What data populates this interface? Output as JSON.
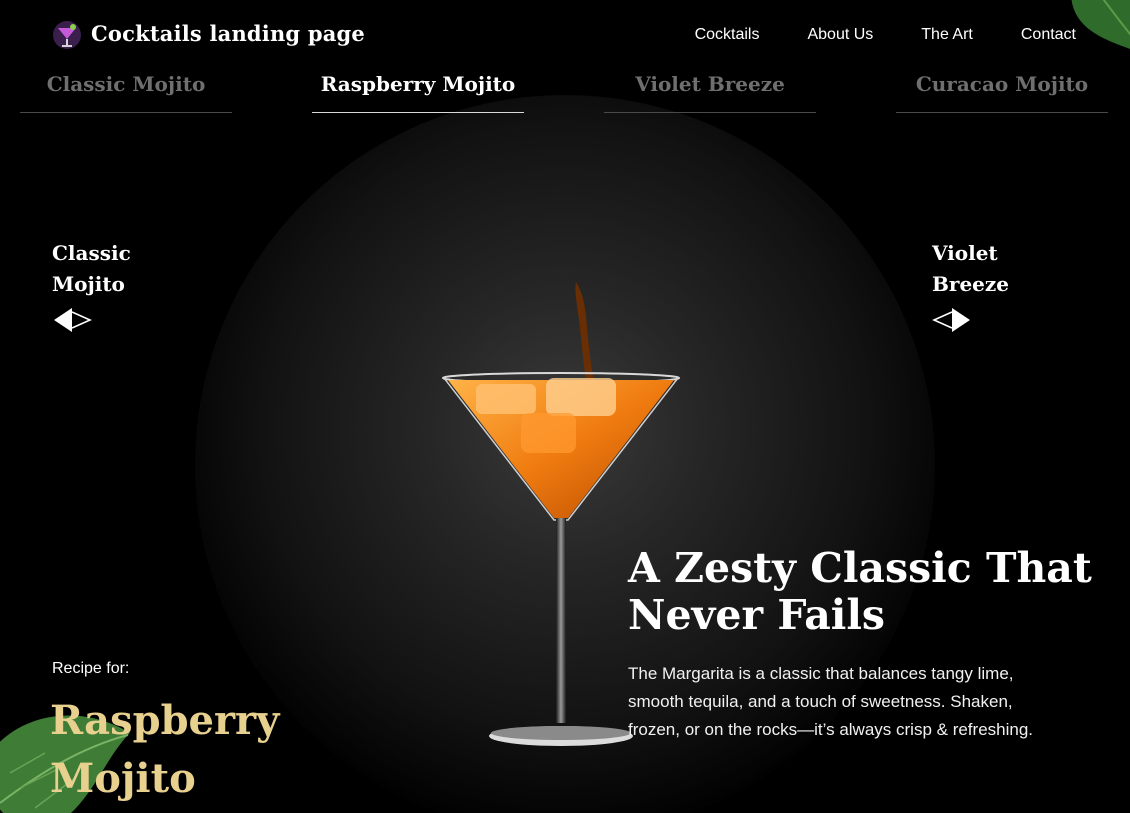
{
  "header": {
    "brand": "Cocktails landing page",
    "nav": [
      "Cocktails",
      "About Us",
      "The Art",
      "Contact"
    ]
  },
  "tabs": [
    {
      "label": "Classic Mojito",
      "active": false
    },
    {
      "label": "Raspberry Mojito",
      "active": true
    },
    {
      "label": "Violet Breeze",
      "active": false
    },
    {
      "label": "Curacao Mojito",
      "active": false
    }
  ],
  "prev": {
    "name": "Classic Mojito"
  },
  "next": {
    "name": "Violet Breeze"
  },
  "recipe": {
    "label": "Recipe for:",
    "name": "Raspberry Mojito"
  },
  "content": {
    "headline": "A Zesty Classic That Never Fails",
    "description": "The Margarita is a classic that balances tangy lime, smooth tequila, and a touch of sweetness. Shaken, frozen, or on the rocks—it’s always crisp & refreshing."
  },
  "colors": {
    "background": "#000000",
    "accent_gold": "#e8d08f",
    "drink_orange": "#f07c10",
    "inactive_tab": "#6f6f6f"
  },
  "icons": {
    "logo": "cocktail-glass-icon",
    "prev": "arrow-left-icon",
    "next": "arrow-right-icon"
  }
}
